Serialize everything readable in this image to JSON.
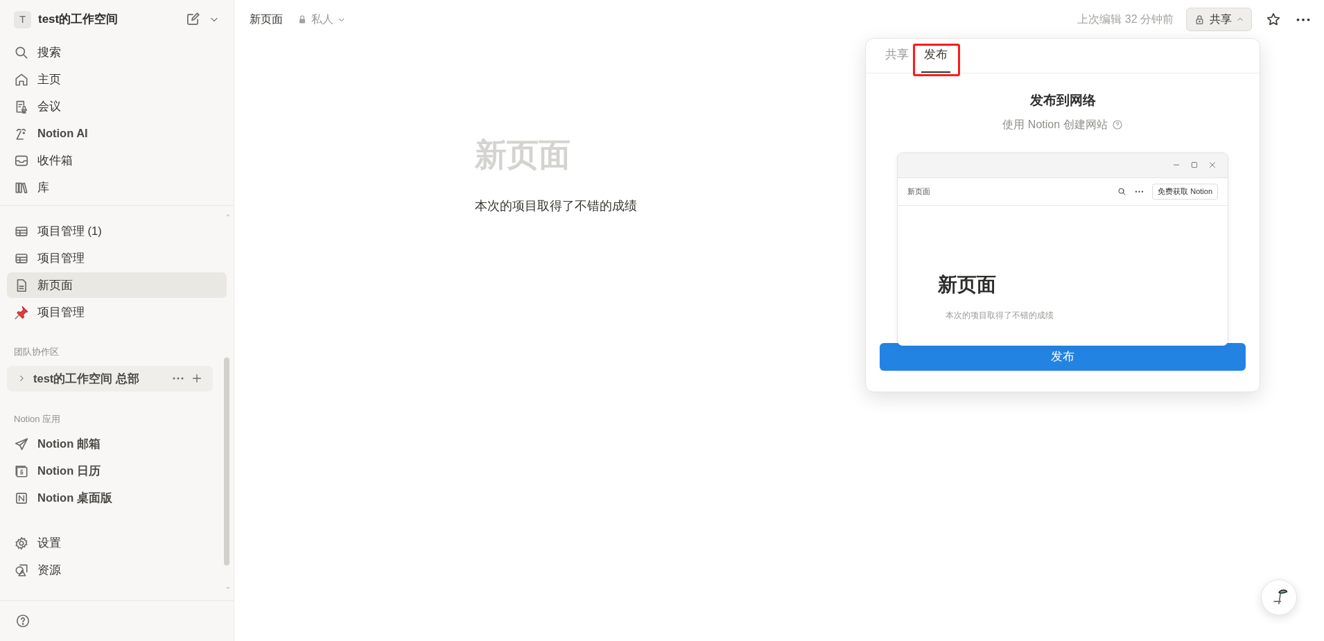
{
  "workspace": {
    "initial": "T",
    "name": "test的工作空间"
  },
  "sidebar": {
    "nav": [
      {
        "label": "搜索"
      },
      {
        "label": "主页"
      },
      {
        "label": "会议"
      },
      {
        "label": "Notion AI"
      },
      {
        "label": "收件箱"
      },
      {
        "label": "库"
      }
    ],
    "private_pages": [
      {
        "label": "项目管理 (1)",
        "selected": false
      },
      {
        "label": "项目管理",
        "selected": false
      },
      {
        "label": "新页面",
        "selected": true
      },
      {
        "label": "项目管理",
        "selected": false
      }
    ],
    "team_section": {
      "label": "团队协作区",
      "items": [
        {
          "label": "test的工作空间 总部",
          "expanded": false
        }
      ]
    },
    "apps_section": {
      "label": "Notion 应用",
      "items": [
        {
          "label": "Notion 邮箱"
        },
        {
          "label": "Notion 日历"
        },
        {
          "label": "Notion 桌面版"
        }
      ]
    },
    "bottom_nav": [
      {
        "label": "设置"
      },
      {
        "label": "资源"
      }
    ]
  },
  "topbar": {
    "breadcrumb": "新页面",
    "privacy": "私人",
    "last_edited": "上次编辑 32 分钟前",
    "share_button": "共享"
  },
  "page": {
    "title": "新页面",
    "body": "本次的项目取得了不错的成绩"
  },
  "popup": {
    "tabs": [
      {
        "label": "共享",
        "selected": false
      },
      {
        "label": "发布",
        "selected": true
      }
    ],
    "heading": "发布到网络",
    "subheading": "使用 Notion 创建网站",
    "preview": {
      "page_title": "新页面",
      "get_button": "免费获取 Notion",
      "title": "新页面",
      "body": "本次的项目取得了不错的成绩"
    },
    "publish_button": "发布"
  }
}
